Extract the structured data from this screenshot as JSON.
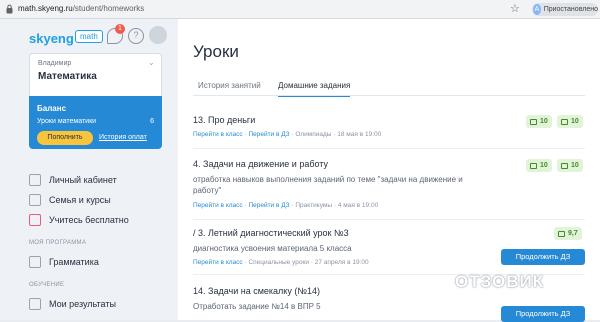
{
  "browser": {
    "url_host": "math.skyeng.ru",
    "url_path": "/student/homeworks",
    "profile_initial": "A",
    "profile_label": "Приостановлено"
  },
  "logo": {
    "brand": "skyeng",
    "tag": "math"
  },
  "header": {
    "notification_count": "1",
    "help": "?"
  },
  "subject": {
    "label": "Владимир",
    "value": "Математика"
  },
  "balance": {
    "title": "Баланс",
    "row_label": "Уроки математики",
    "row_value": "6",
    "topup": "Пополнить",
    "history": "История оплат"
  },
  "nav": {
    "cabinet": "Личный кабинет",
    "family": "Семья и курсы",
    "free": "Учитесь бесплатно",
    "section_program": "МОЯ ПРОГРАММА",
    "grammar": "Грамматика",
    "section_learning": "ОБУЧЕНИЕ",
    "results": "Мои результаты"
  },
  "page": {
    "title": "Уроки",
    "tabs": [
      "История занятий",
      "Домашние задания"
    ]
  },
  "items": [
    {
      "title": "13. Про деньги",
      "desc": "",
      "links": [
        "Перейти в класс",
        "Перейти в ДЗ"
      ],
      "category": "Олимпиады",
      "date": "18 мая в 19:00",
      "score1": "10",
      "score2": "10",
      "button": ""
    },
    {
      "title": "4. Задачи на движение и работу",
      "desc": "отработка навыков выполнения заданий по теме \"задачи на движение и работу\"",
      "links": [
        "Перейти в класс",
        "Перейти в ДЗ"
      ],
      "category": "Практикумы",
      "date": "4 мая в 19:00",
      "score1": "10",
      "score2": "10",
      "button": ""
    },
    {
      "title": "/ 3. Летний диагностический урок №3",
      "desc": "диагностика усвоения материала 5 класса",
      "links": [
        "Перейти в класс"
      ],
      "category": "Специальные уроки",
      "date": "27 апреля в 19:00",
      "score1": "9,7",
      "score2": "",
      "button": "Продолжить ДЗ"
    },
    {
      "title": "14. Задачи на смекалку (№14)",
      "desc": "Отработать задание №14 в ВПР 5",
      "links": [],
      "category": "",
      "date": "",
      "score1": "",
      "score2": "",
      "button": "Продолжить ДЗ"
    }
  ],
  "watermark": "ОТЗОВИК"
}
